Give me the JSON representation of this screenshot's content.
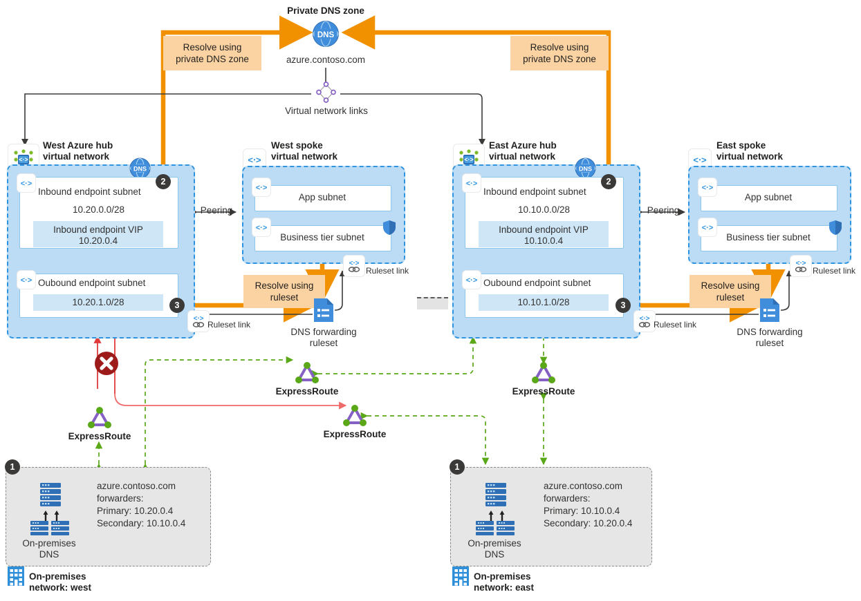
{
  "diagram": {
    "title": "Private DNS zone",
    "zone_name": "azure.contoso.com",
    "vnet_links_label": "Virtual network links"
  },
  "callouts": {
    "west_private": "Resolve using\nprivate DNS zone",
    "east_private": "Resolve using\nprivate DNS zone",
    "west_ruleset": "Resolve using\nruleset",
    "east_ruleset": "Resolve using\nruleset"
  },
  "west_hub": {
    "title": "West Azure hub\nvirtual network",
    "inbound_subnet_label": "Inbound endpoint subnet",
    "inbound_cidr": "10.20.0.0/28",
    "vip_label": "Inbound endpoint VIP",
    "vip_address": "10.20.0.4",
    "outbound_subnet_label": "Oubound endpoint subnet",
    "outbound_cidr": "10.20.1.0/28",
    "badge_inbound": "2",
    "badge_outbound": "3",
    "ruleset_link_label": "Ruleset link"
  },
  "west_spoke": {
    "title": "West spoke\nvirtual network",
    "app_subnet": "App subnet",
    "business_subnet": "Business tier subnet",
    "ruleset_link_label": "Ruleset link",
    "ruleset_name": "DNS forwarding\nruleset"
  },
  "east_hub": {
    "title": "East Azure hub\nvirtual network",
    "inbound_subnet_label": "Inbound endpoint subnet",
    "inbound_cidr": "10.10.0.0/28",
    "vip_label": "Inbound endpoint VIP",
    "vip_address": "10.10.0.4",
    "outbound_subnet_label": "Oubound endpoint subnet",
    "outbound_cidr": "10.10.1.0/28",
    "badge_inbound": "2",
    "badge_outbound": "3",
    "ruleset_link_label": "Ruleset link"
  },
  "east_spoke": {
    "title": "East spoke\nvirtual network",
    "app_subnet": "App subnet",
    "business_subnet": "Business tier subnet",
    "ruleset_link_label": "Ruleset link",
    "ruleset_name": "DNS forwarding\nruleset"
  },
  "peering": {
    "west_label": "Peering",
    "east_label": "Peering"
  },
  "expressroute": {
    "west_lower": "ExpressRoute",
    "west_mid": "ExpressRoute",
    "center": "ExpressRoute",
    "east": "ExpressRoute"
  },
  "onprem_west": {
    "badge": "1",
    "dns_label": "On-premises\nDNS",
    "forwarders_title": "azure.contoso.com",
    "forwarders_sub": "forwarders:",
    "primary": "Primary: 10.20.0.4",
    "secondary": "Secondary: 10.10.0.4",
    "network_label": "On-premises\nnetwork: west"
  },
  "onprem_east": {
    "badge": "1",
    "dns_label": "On-premises\nDNS",
    "forwarders_title": "azure.contoso.com",
    "forwarders_sub": "forwarders:",
    "primary": "Primary: 10.10.0.4",
    "secondary": "Secondary: 10.20.0.4",
    "network_label": "On-premises\nnetwork: east"
  },
  "icons": {
    "dns_zone": "dns-globe-icon",
    "vnet": "virtual-network-icon",
    "subnet": "subnet-icon",
    "vnet_link": "virtual-network-link-icon",
    "ruleset_link": "ruleset-link-icon",
    "ruleset_doc": "dns-forwarding-ruleset-icon",
    "shield": "security-shield-icon",
    "expressroute": "expressroute-icon",
    "server": "dns-server-icon",
    "building": "on-premises-building-icon",
    "blocked": "blocked-x-icon"
  },
  "colors": {
    "orange": "#f29100",
    "callout_bg": "#fbd3a2",
    "vnet_fill": "#bcdcf5",
    "vnet_border": "#2f94e0",
    "subnet_inner": "#cfe6f7",
    "green": "#5aa818",
    "red": "#e03a3a",
    "blocked_red": "#9e1b1b",
    "badge_grey": "#3b3a39",
    "azure_blue": "#3a7fc4",
    "purple": "#8661c5"
  }
}
